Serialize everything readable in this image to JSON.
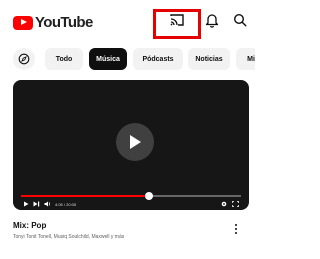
{
  "header": {
    "logo_text": "YouTube",
    "icons": {
      "cast": "cast-icon",
      "notifications": "bell-icon",
      "search": "search-icon"
    },
    "highlight_color": "#e60000"
  },
  "chips": {
    "explore_icon": "compass-icon",
    "items": [
      {
        "label": "Todo",
        "active": false
      },
      {
        "label": "Música",
        "active": true
      },
      {
        "label": "Pódcasts",
        "active": false
      },
      {
        "label": "Noticias",
        "active": false
      },
      {
        "label": "Mix",
        "active": false
      }
    ]
  },
  "player": {
    "time": "4:05 / 20:05",
    "progress": 0.58,
    "progress_color": "#ff0000"
  },
  "video": {
    "title": "Mix: Pop",
    "subtitle": "Tonyi Tonit Tonell, Musiq Soulchild, Maxwell y más"
  }
}
